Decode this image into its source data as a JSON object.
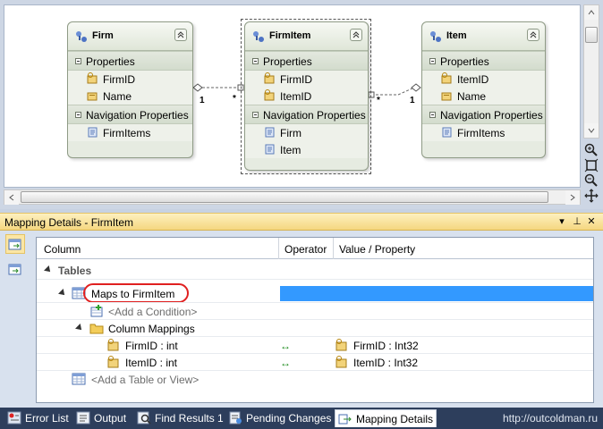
{
  "designer": {
    "entities": [
      {
        "title": "Firm",
        "properties_header": "Properties",
        "properties": [
          "FirmID",
          "Name"
        ],
        "nav_header": "Navigation Properties",
        "nav_properties": [
          "FirmItems"
        ]
      },
      {
        "title": "FirmItem",
        "properties_header": "Properties",
        "properties": [
          "FirmID",
          "ItemID"
        ],
        "nav_header": "Navigation Properties",
        "nav_properties": [
          "Firm",
          "Item"
        ]
      },
      {
        "title": "Item",
        "properties_header": "Properties",
        "properties": [
          "ItemID",
          "Name"
        ],
        "nav_header": "Navigation Properties",
        "nav_properties": [
          "FirmItems"
        ]
      }
    ],
    "associations": [
      {
        "left_mult": "1",
        "right_mult": "*"
      },
      {
        "left_mult": "*",
        "right_mult": "1"
      }
    ]
  },
  "tool_window": {
    "title": "Mapping Details - FirmItem",
    "columns": [
      "Column",
      "Operator",
      "Value / Property"
    ],
    "tables_label": "Tables",
    "table_name": "Maps to FirmItem",
    "add_condition": "<Add a Condition>",
    "column_mappings_label": "Column Mappings",
    "mappings": [
      {
        "column": "FirmID : int",
        "operator": "↔",
        "property": "FirmID : Int32"
      },
      {
        "column": "ItemID : int",
        "operator": "↔",
        "property": "ItemID : Int32"
      }
    ],
    "add_table": "<Add a Table or View>"
  },
  "tabs": [
    {
      "label": "Error List",
      "icon": "error-list-icon"
    },
    {
      "label": "Output",
      "icon": "output-icon"
    },
    {
      "label": "Find Results 1",
      "icon": "find-results-icon"
    },
    {
      "label": "Pending Changes",
      "icon": "pending-changes-icon"
    },
    {
      "label": "Mapping Details",
      "icon": "mapping-details-icon",
      "active": true
    }
  ],
  "watermark": "http://outcoldman.ru",
  "colors": {
    "selection": "#3399ff",
    "annotation_oval": "#e02020",
    "tool_title": "#f5d780",
    "tab_bar": "#2d3e5c"
  }
}
